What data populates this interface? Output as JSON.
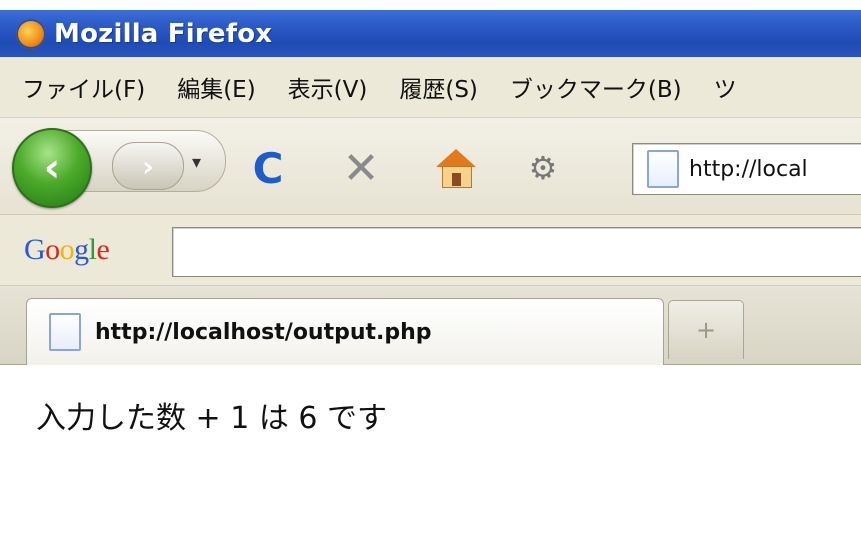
{
  "window": {
    "title": "Mozilla Firefox"
  },
  "menu": {
    "items": [
      "ファイル(F)",
      "編集(E)",
      "表示(V)",
      "履歴(S)",
      "ブックマーク(B)",
      "ツ"
    ]
  },
  "toolbar": {
    "back_glyph": "‹",
    "forward_glyph": "›",
    "history_dropdown_glyph": "▾",
    "reload_glyph": "C",
    "stop_glyph": "✕",
    "bookmark_glyph": "⚙",
    "url_text": "http://local"
  },
  "search": {
    "logo_parts": [
      "G",
      "o",
      "o",
      "g",
      "l",
      "e"
    ],
    "value": ""
  },
  "tabs": {
    "active_title": "http://localhost/output.php",
    "new_tab_glyph": "+"
  },
  "page": {
    "text": "入力した数 + 1 は 6 です"
  },
  "icons": {
    "app": "firefox-logo-icon",
    "back": "back-arrow-icon",
    "forward": "forward-arrow-icon",
    "reload": "reload-icon",
    "stop": "stop-icon",
    "home": "home-icon",
    "bookmark": "bookmark-icon",
    "page": "page-icon"
  },
  "colors": {
    "titlebar": "#2b59c6",
    "chrome": "#ece9d8",
    "back_button": "#4caa2a",
    "reload": "#1e5cc8"
  }
}
